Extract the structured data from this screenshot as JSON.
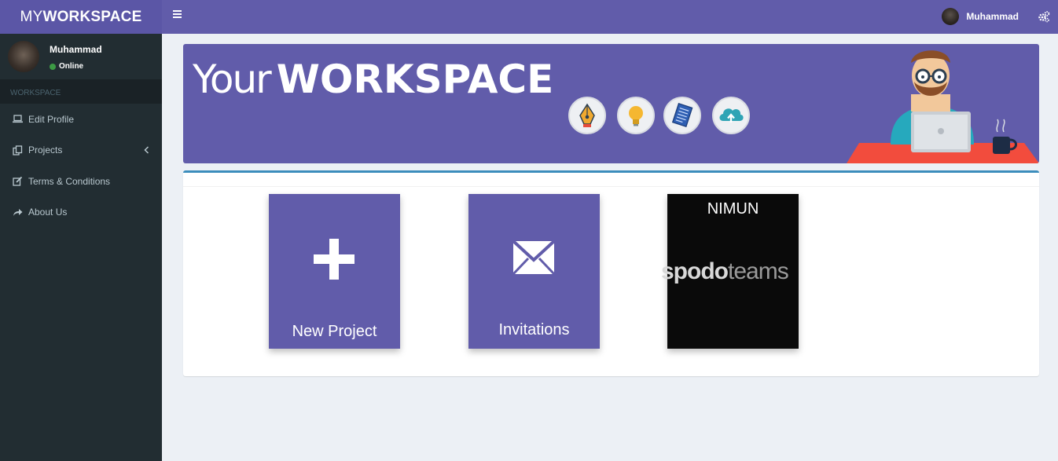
{
  "header": {
    "logo_light": "MY",
    "logo_bold": "WORKSPACE",
    "user_name": "Muhammad"
  },
  "sidebar": {
    "user_name": "Muhammad",
    "status": "Online",
    "section": "WORKSPACE",
    "items": [
      {
        "label": "Edit Profile",
        "icon": "laptop-icon"
      },
      {
        "label": "Projects",
        "icon": "files-icon"
      },
      {
        "label": "Terms & Conditions",
        "icon": "edit-icon"
      },
      {
        "label": "About Us",
        "icon": "share-icon"
      }
    ]
  },
  "banner": {
    "title_light": "Your",
    "title_bold": "WORKSPACE",
    "icons": [
      "pen-nib-icon",
      "lightbulb-icon",
      "document-icon",
      "cloud-upload-icon"
    ]
  },
  "cards": [
    {
      "label": "New Project",
      "icon": "plus-icon"
    },
    {
      "label": "Invitations",
      "icon": "envelope-icon"
    },
    {
      "label": "NIMUN",
      "logo_bold": "spodo",
      "logo_light": "teams"
    }
  ],
  "colors": {
    "header": "#615caa",
    "logo_bg": "#5b56a6",
    "sidebar": "#222d32",
    "body_bg": "#ecf0f5",
    "box_top_border": "#3c8dbc",
    "status_online": "#3c9a44"
  }
}
